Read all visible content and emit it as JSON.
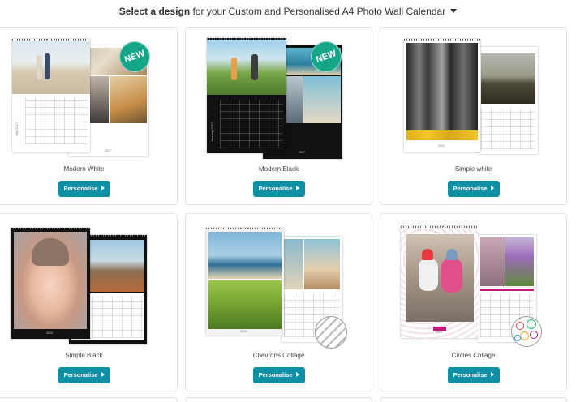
{
  "header": {
    "strong": "Select a design",
    "rest": " for your Custom and Personalised A4 Photo Wall Calendar"
  },
  "designs": [
    {
      "name": "Modern White",
      "button": "Personalise",
      "badge": "NEW",
      "month": "July 2017",
      "year": "2017"
    },
    {
      "name": "Modern Black",
      "button": "Personalise",
      "badge": "NEW",
      "month": "January 2017",
      "year": "2017"
    },
    {
      "name": "Simple white",
      "button": "Personalise",
      "year": "2016"
    },
    {
      "name": "Simple Black",
      "button": "Personalise",
      "year": "2016"
    },
    {
      "name": "Chevrons Collage",
      "button": "Personalise",
      "year": "2016"
    },
    {
      "name": "Circles Collage",
      "button": "Personalise",
      "year": "2016"
    }
  ],
  "colors": {
    "button_bg": "#0e8fa3",
    "badge_bg": "#17a589",
    "card_border": "#e3e3e3"
  },
  "icons": {
    "header_dropdown": "caret-down-icon",
    "button_arrow": "caret-right-icon"
  }
}
